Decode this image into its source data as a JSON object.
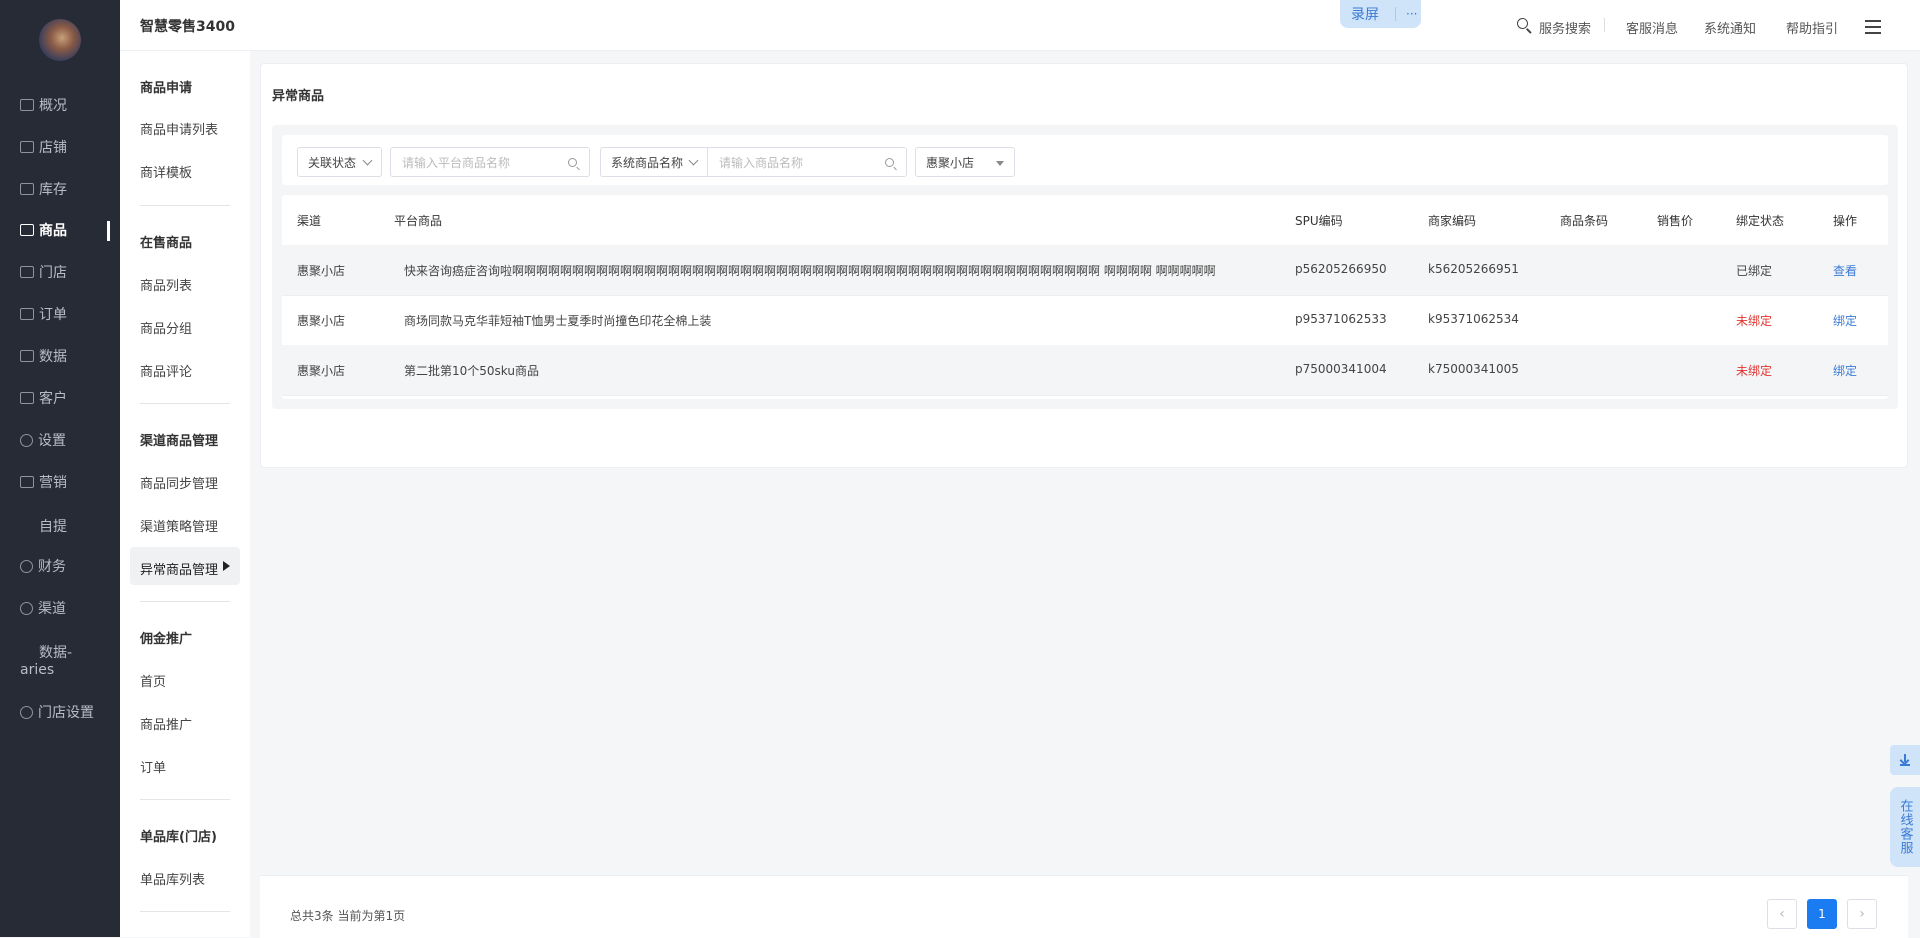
{
  "app": {
    "title": "智慧零售3400"
  },
  "header": {
    "record": "录屏",
    "more": "···",
    "service_search": "服务搜索",
    "customer_msg": "客服消息",
    "system_notice": "系统通知",
    "help": "帮助指引"
  },
  "nav": {
    "items": [
      {
        "label": "概况"
      },
      {
        "label": "店铺"
      },
      {
        "label": "库存"
      },
      {
        "label": "商品"
      },
      {
        "label": "门店"
      },
      {
        "label": "订单"
      },
      {
        "label": "数据"
      },
      {
        "label": "客户"
      },
      {
        "label": "设置"
      },
      {
        "label": "营销"
      },
      {
        "label": "自提"
      },
      {
        "label": "财务"
      },
      {
        "label": "渠道"
      },
      {
        "label": "数据-aries"
      },
      {
        "label": "门店设置"
      }
    ],
    "data_aries_line1": "数据-",
    "data_aries_line2": "aries"
  },
  "subnav": {
    "groups": [
      {
        "title": "商品申请",
        "items": [
          "商品申请列表",
          "商详模板"
        ]
      },
      {
        "title": "在售商品",
        "items": [
          "商品列表",
          "商品分组",
          "商品评论"
        ]
      },
      {
        "title": "渠道商品管理",
        "items": [
          "商品同步管理",
          "渠道策略管理",
          "异常商品管理"
        ]
      },
      {
        "title": "佣金推广",
        "items": [
          "首页",
          "商品推广",
          "订单"
        ]
      },
      {
        "title": "单品库(门店)",
        "items": [
          "单品库列表"
        ]
      }
    ]
  },
  "page": {
    "title": "异常商品",
    "filters": {
      "status_label": "关联状态",
      "platform_placeholder": "请输入平台商品名称",
      "sys_field_label": "系统商品名称",
      "sys_placeholder": "请输入商品名称",
      "store": "惠聚小店"
    },
    "table": {
      "headers": [
        "渠道",
        "平台商品",
        "SPU编码",
        "商家编码",
        "商品条码",
        "销售价",
        "绑定状态",
        "操作"
      ],
      "rows": [
        {
          "channel": "惠聚小店",
          "product": "快来咨询癌症咨询啦啊啊啊啊啊啊啊啊啊啊啊啊啊啊啊啊啊啊啊啊啊啊啊啊啊啊啊啊啊啊啊啊啊啊啊啊啊啊啊啊啊啊啊啊啊啊啊啊啊 啊啊啊啊 啊啊啊啊啊",
          "spu": "p56205266950",
          "merchant": "k56205266951",
          "barcode": "",
          "price": "",
          "status": "已绑定",
          "action": "查看"
        },
        {
          "channel": "惠聚小店",
          "product": "商场同款马克华菲短袖T恤男士夏季时尚撞色印花全棉上装",
          "spu": "p95371062533",
          "merchant": "k95371062534",
          "barcode": "",
          "price": "",
          "status": "未绑定",
          "action": "绑定"
        },
        {
          "channel": "惠聚小店",
          "product": "第二批第10个50sku商品",
          "spu": "p75000341004",
          "merchant": "k75000341005",
          "barcode": "",
          "price": "",
          "status": "未绑定",
          "action": "绑定"
        }
      ]
    },
    "pagination": {
      "summary": "总共3条 当前为第1页",
      "prev": "‹",
      "current": "1",
      "next": "›"
    }
  },
  "float": {
    "customer_service": "在线客服"
  },
  "colors": {
    "nav_bg": "#272b36",
    "accent": "#1a7cf0",
    "link": "#3a7bd5",
    "danger": "#e0342f"
  }
}
